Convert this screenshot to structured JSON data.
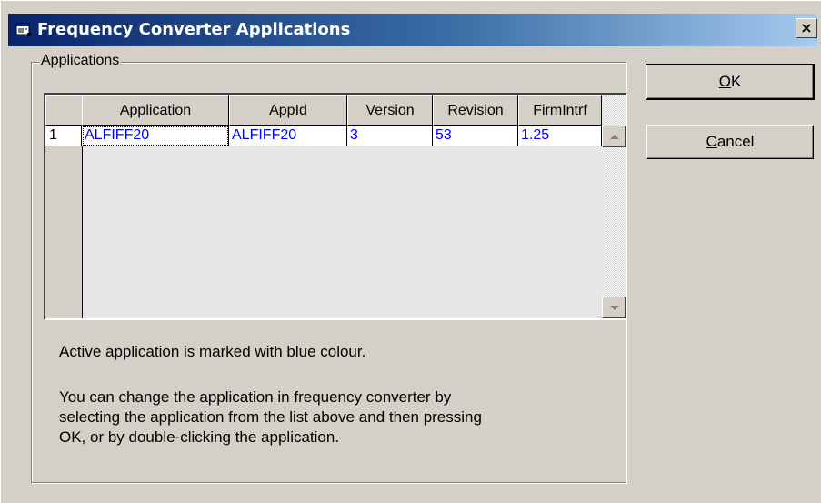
{
  "window": {
    "title": "Frequency Converter Applications",
    "close_label": "×"
  },
  "group": {
    "label": "Applications"
  },
  "grid": {
    "columns": [
      "Application",
      "AppId",
      "Version",
      "Revision",
      "FirmIntrf"
    ],
    "rows": [
      {
        "index": "1",
        "cells": [
          "ALFIFF20",
          "ALFIFF20",
          "3",
          "53",
          "1.25"
        ]
      }
    ],
    "active_color": "#0000ff"
  },
  "notes": {
    "line1": "Active application is marked with blue colour.",
    "line2a": "You can change the application in frequency converter by",
    "line2b": "selecting the application from the list above and then pressing",
    "line2c": "OK, or by double-clicking the application."
  },
  "buttons": {
    "ok_accel": "O",
    "ok_rest": "K",
    "cancel_accel": "C",
    "cancel_rest": "ancel"
  },
  "icons": {
    "title": "window-app-icon",
    "scroll_up": "arrow-up-icon",
    "scroll_down": "arrow-down-icon"
  }
}
